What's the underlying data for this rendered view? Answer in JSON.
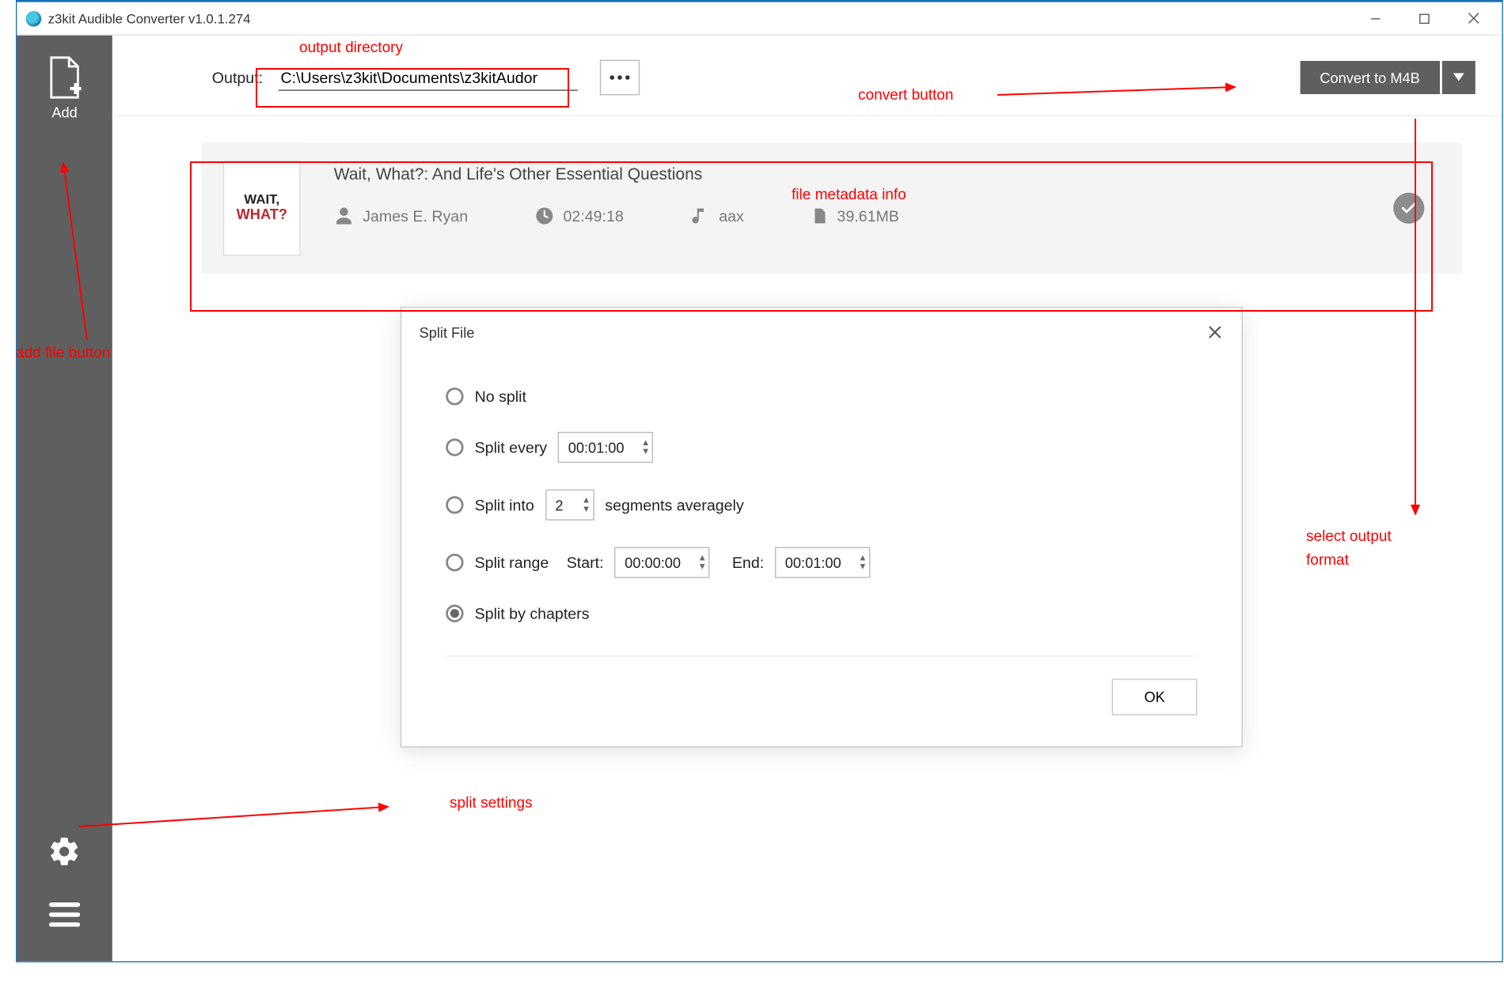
{
  "window": {
    "title": "z3kit Audible Converter v1.0.1.274"
  },
  "sidebar": {
    "add_label": "Add"
  },
  "topbar": {
    "output_label": "Output:",
    "output_path": "C:\\Users\\z3kit\\Documents\\z3kitAudor",
    "convert_label": "Convert to M4B"
  },
  "file": {
    "cover_line1": "WAIT,",
    "cover_line2": "WHAT?",
    "title": "Wait, What?: And Life's Other Essential Questions",
    "author": "James E. Ryan",
    "duration": "02:49:18",
    "format": "aax",
    "size": "39.61MB"
  },
  "dialog": {
    "title": "Split File",
    "no_split": "No split",
    "split_every": "Split every",
    "split_every_val": "00:01:00",
    "split_into": "Split into",
    "split_into_val": "2",
    "segments_suffix": "segments averagely",
    "split_range": "Split range",
    "start_label": "Start:",
    "start_val": "00:00:00",
    "end_label": "End:",
    "end_val": "00:01:00",
    "split_chapters": "Split by chapters",
    "ok": "OK"
  },
  "annotations": {
    "output_dir": "output directory",
    "convert_btn": "convert button",
    "add_btn": "add file button",
    "file_info": "file metadata info",
    "select_format_l1": "select output",
    "select_format_l2": "format",
    "split": "split settings"
  }
}
